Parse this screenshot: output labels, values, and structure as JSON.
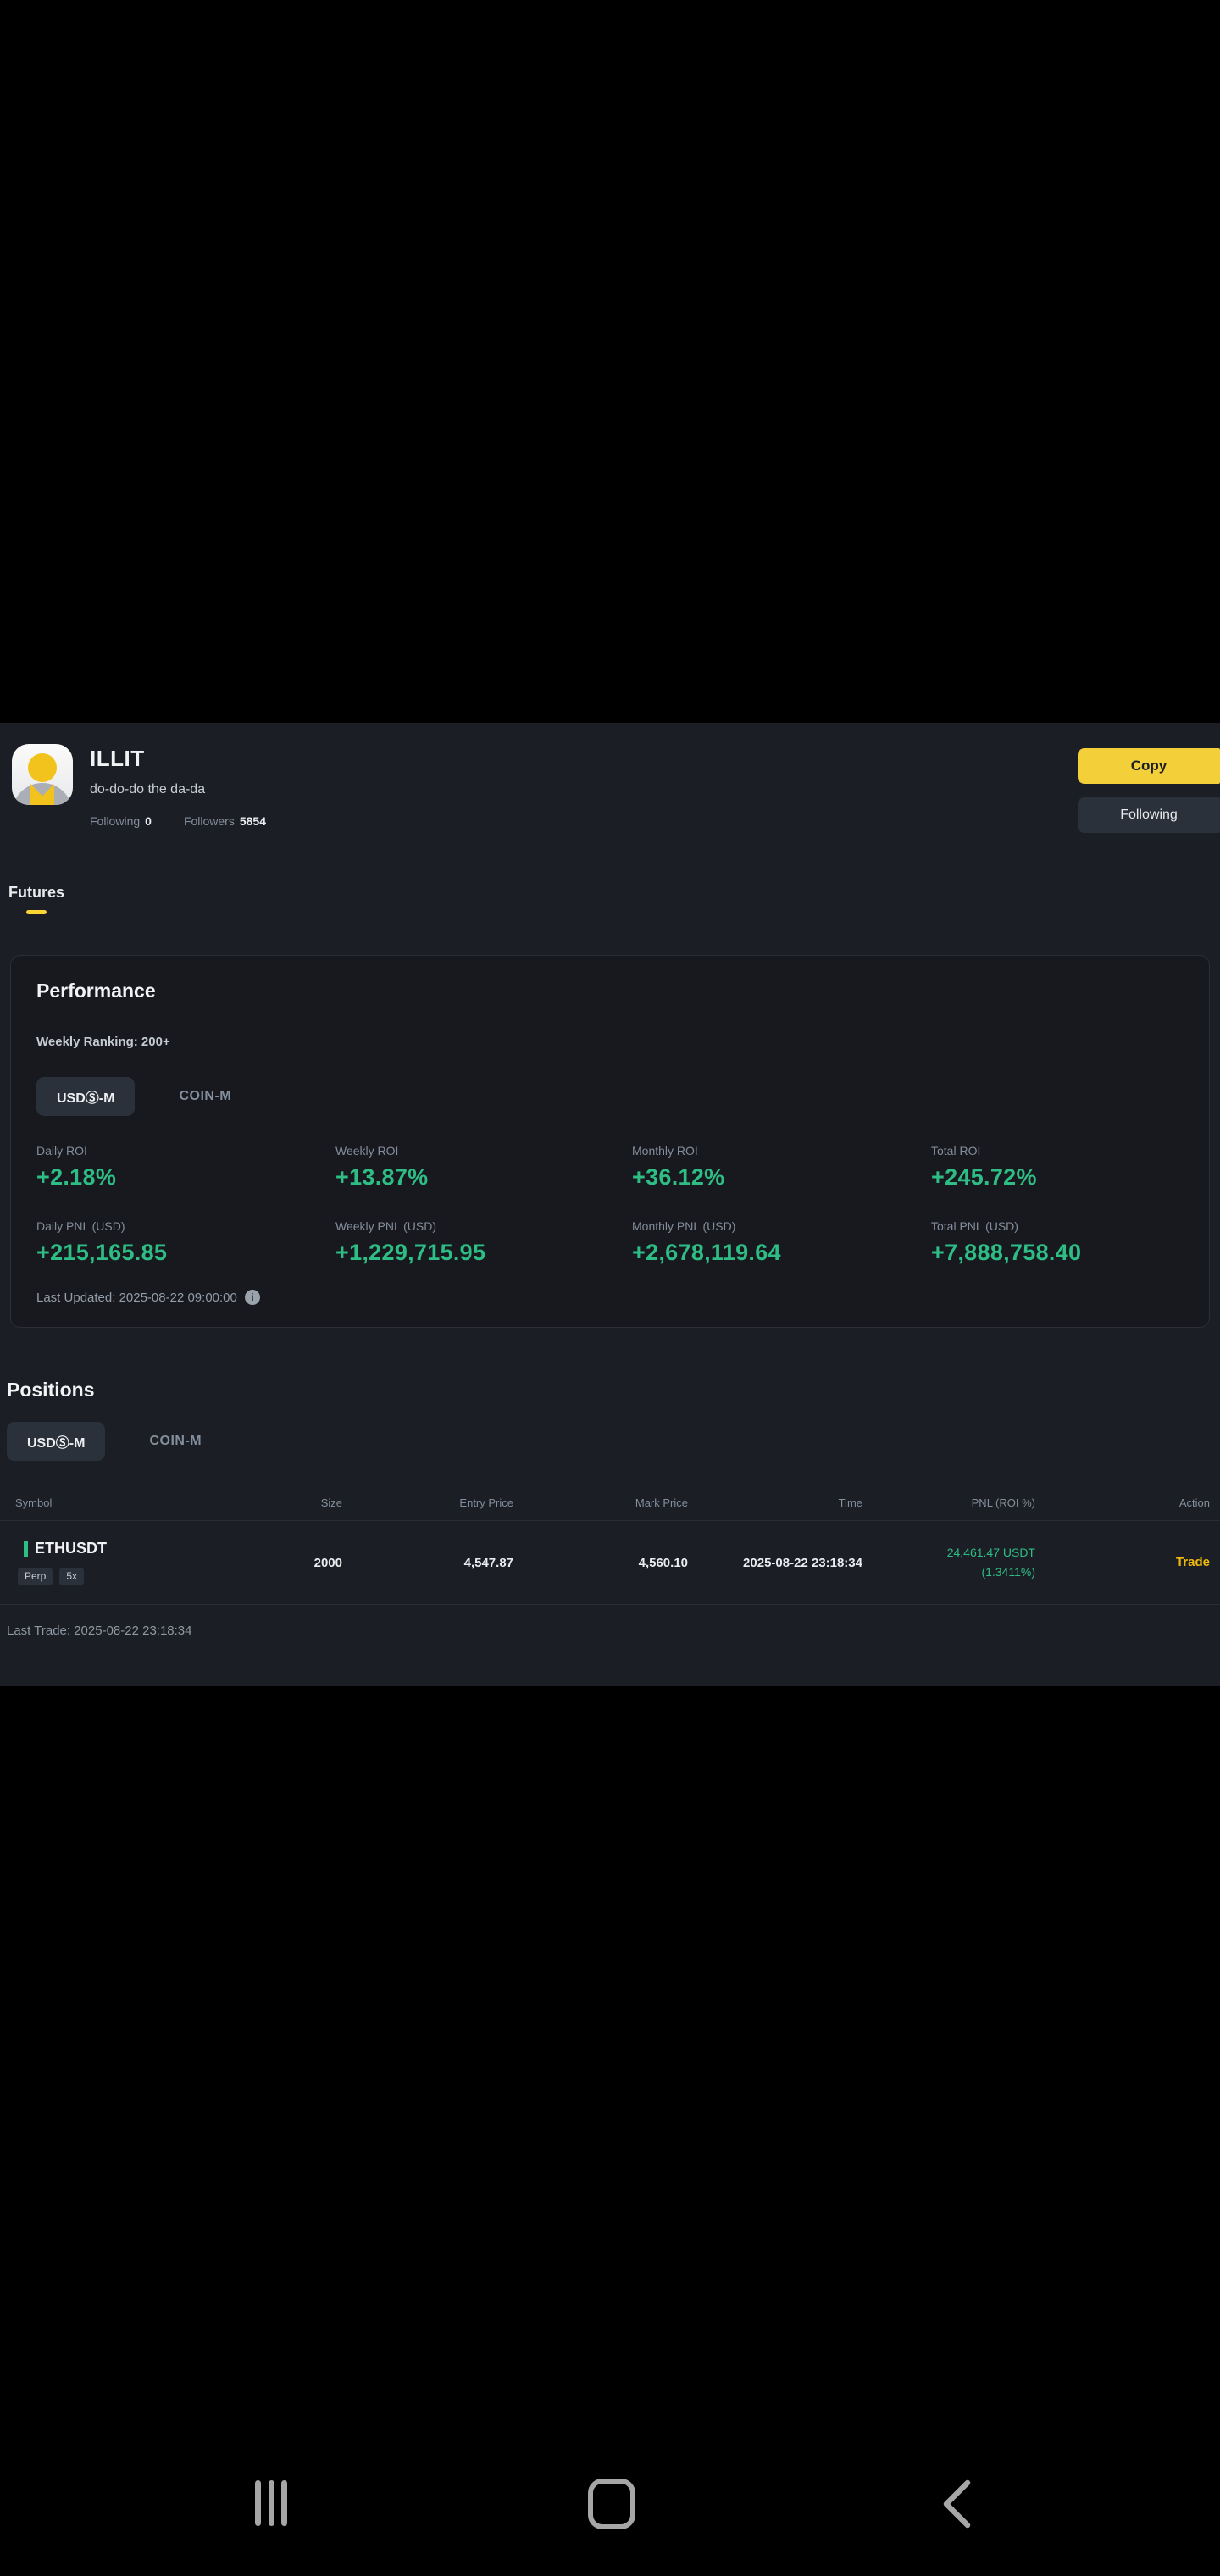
{
  "colors": {
    "accent_yellow": "#FCD535",
    "positive_green": "#2EBD85",
    "trade_link_yellow": "#F0B90B",
    "app_background": "#1B1E24",
    "pill_background": "#2B313A"
  },
  "profile": {
    "name": "ILLIT",
    "bio": "do-do-do the da-da",
    "stats": [
      {
        "label": "Following",
        "value": "0"
      },
      {
        "label": "Followers",
        "value": "5854"
      }
    ],
    "copy_button_label": "Copy",
    "following_button_label": "Following"
  },
  "page_tabs": [
    {
      "label": "Futures",
      "selected": true
    }
  ],
  "performance": {
    "title": "Performance",
    "weekly_ranking": "Weekly Ranking: 200+",
    "market_tabs": [
      {
        "label": "USDⓈ-M",
        "selected": true
      },
      {
        "label": "COIN-M",
        "selected": false
      }
    ],
    "metrics": [
      {
        "label": "Daily ROI",
        "value": "+2.18%"
      },
      {
        "label": "Weekly ROI",
        "value": "+13.87%"
      },
      {
        "label": "Monthly ROI",
        "value": "+36.12%"
      },
      {
        "label": "Total ROI",
        "value": "+245.72%"
      },
      {
        "label": "Daily PNL (USD)",
        "value": "+215,165.85"
      },
      {
        "label": "Weekly PNL (USD)",
        "value": "+1,229,715.95"
      },
      {
        "label": "Monthly PNL (USD)",
        "value": "+2,678,119.64"
      },
      {
        "label": "Total PNL (USD)",
        "value": "+7,888,758.40"
      }
    ],
    "last_updated": "Last Updated: 2025-08-22 09:00:00"
  },
  "positions": {
    "title": "Positions",
    "market_tabs": [
      {
        "label": "USDⓈ-M",
        "selected": true
      },
      {
        "label": "COIN-M",
        "selected": false
      }
    ],
    "table": {
      "headers": [
        "Symbol",
        "Size",
        "Entry Price",
        "Mark Price",
        "Time",
        "PNL (ROI %)",
        "Action"
      ],
      "rows": [
        {
          "symbol": "ETHUSDT",
          "badges": [
            "Perp",
            "5x"
          ],
          "size": "2000",
          "entry_price": "4,547.87",
          "mark_price": "4,560.10",
          "time": "2025-08-22 23:18:34",
          "pnl": "24,461.47 USDT",
          "roi": "(1.3411%)",
          "action": "Trade"
        }
      ]
    },
    "last_trade": "Last Trade: 2025-08-22 23:18:34"
  },
  "icons": {
    "info": "i"
  }
}
